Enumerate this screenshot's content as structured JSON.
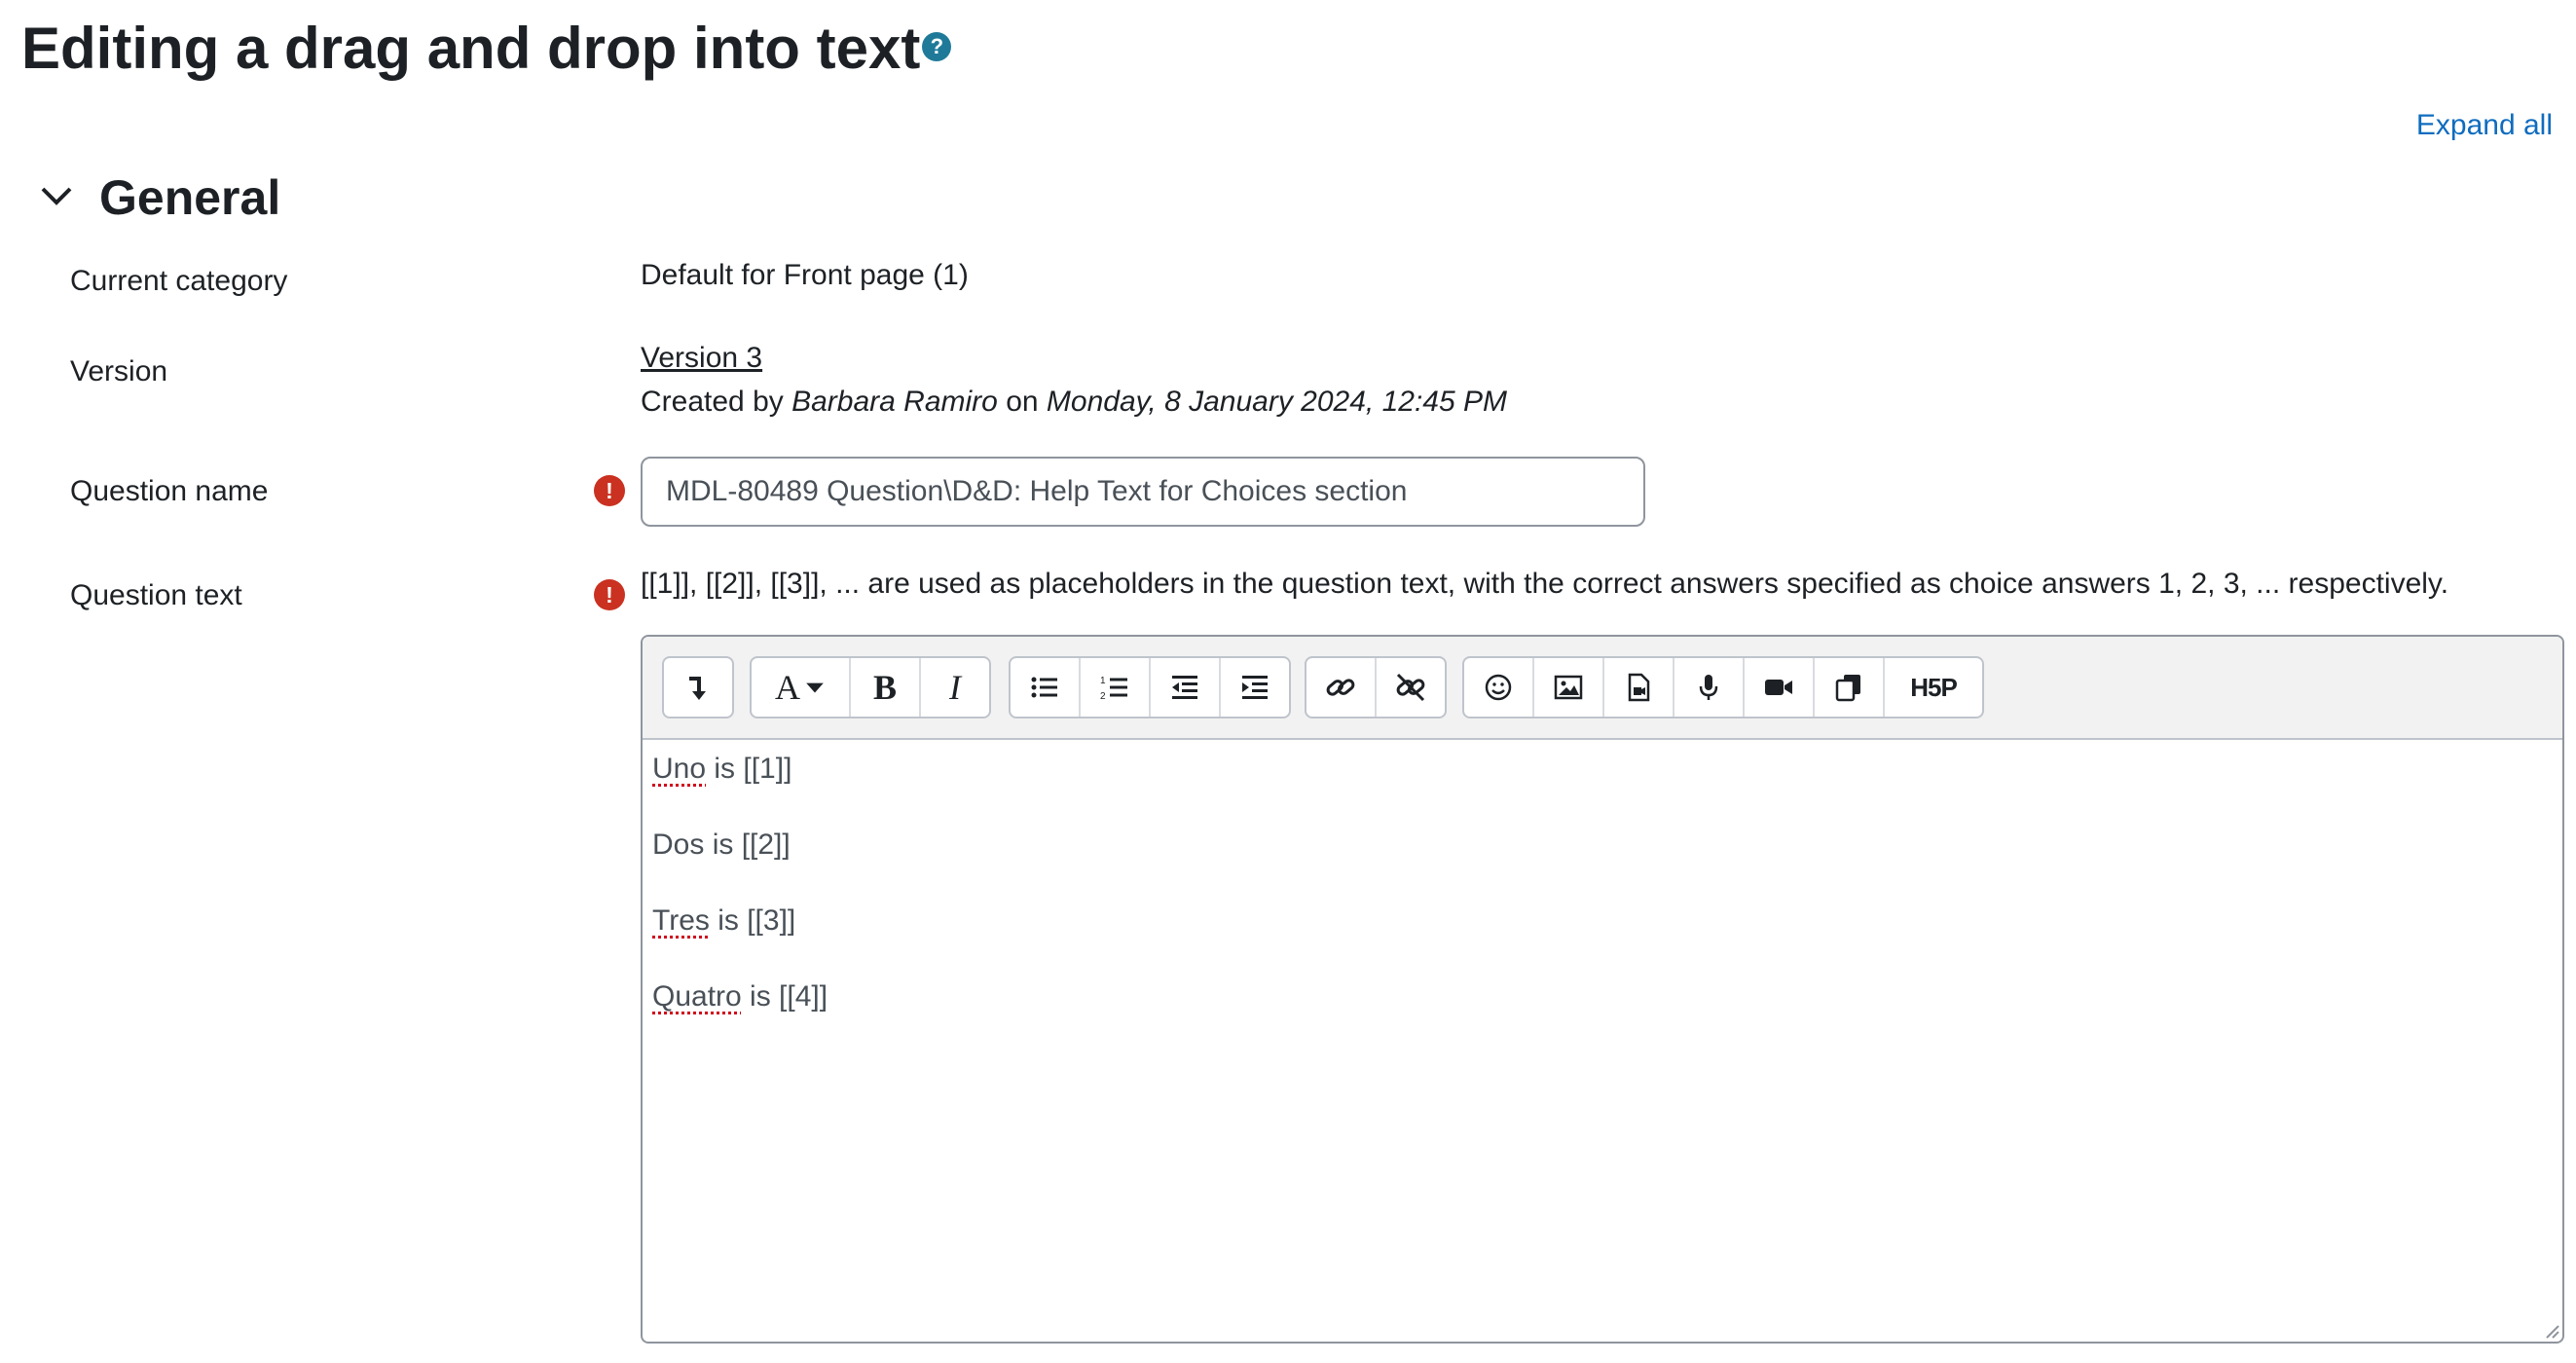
{
  "page": {
    "title": "Editing a drag and drop into text",
    "help_icon_glyph": "?",
    "expand_all": "Expand all"
  },
  "section": {
    "title": "General"
  },
  "fields": {
    "category": {
      "label": "Current category",
      "value": "Default for Front page (1)"
    },
    "version": {
      "label": "Version",
      "link": "Version 3",
      "created_by_prefix": "Created by",
      "author": "Barbara Ramiro",
      "on": "on",
      "date": "Monday, 8 January 2024, 12:45 PM"
    },
    "question_name": {
      "label": "Question name",
      "value": "MDL-80489 Question\\D&D: Help Text for Choices section"
    },
    "question_text": {
      "label": "Question text",
      "help": "[[1]], [[2]], [[3]], ... are used as placeholders in the question text, with the correct answers specified as choice answers 1, 2, 3, ... respectively."
    },
    "required_glyph": "!"
  },
  "editor": {
    "toolbar_icons": [
      "collapse-icon",
      "font-style-icon",
      "bold-icon",
      "italic-icon",
      "unordered-list-icon",
      "ordered-list-icon",
      "outdent-icon",
      "indent-icon",
      "link-icon",
      "unlink-icon",
      "emoji-icon",
      "image-icon",
      "media-icon",
      "record-audio-icon",
      "record-video-icon",
      "manage-files-icon",
      "h5p-icon"
    ],
    "bold_glyph": "B",
    "italic_glyph": "I",
    "font_glyph": "A",
    "h5p_label": "H5P",
    "lines": [
      {
        "word": "Uno",
        "rest": " is [[1]]"
      },
      {
        "word": "Dos",
        "rest": " is [[2]]"
      },
      {
        "word": "Tres",
        "rest": " is [[3]]"
      },
      {
        "word": "Quatro",
        "rest": " is [[4]]"
      }
    ]
  },
  "colors": {
    "link": "#0f6cbf",
    "help": "#1f7a99",
    "required": "#ca3120",
    "spellcheck": "#d0021b"
  }
}
